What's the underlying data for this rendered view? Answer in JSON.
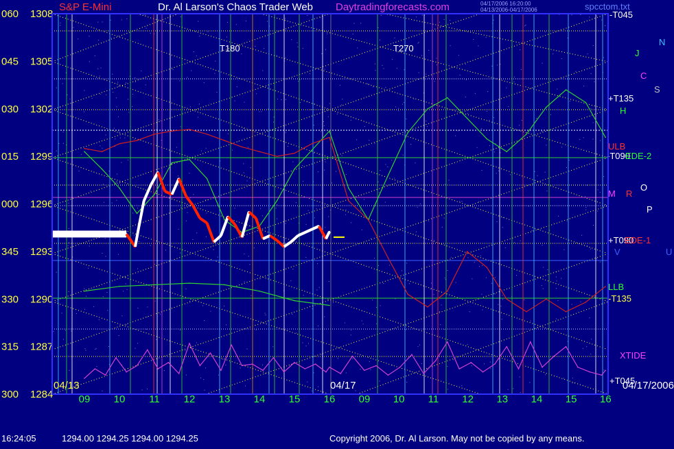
{
  "header": {
    "instrument": "S&P E-Mini",
    "title": "Dr. Al Larson's Chaos Trader Web",
    "site": "Daytradingforecasts.com",
    "stamp_line1": "04/17/2006 16:20:00",
    "stamp_line2": "04/13/2006-04/17/2006",
    "file": "spcctom.txt"
  },
  "footer": {
    "time": "16:24:05",
    "quote": "1294.00 1294.25 1294.00 1294.25",
    "copyright": "Copyright 2006, Dr. Al Larson. May not be copied by any means."
  },
  "colors": {
    "background": "#000080",
    "price_up": "#ffffff",
    "price_down": "#ff2000",
    "grid": "#ffff40",
    "green": "#30d030",
    "red": "#d02020",
    "magenta": "#d040d0",
    "cyan": "#40c0ff"
  },
  "chart_data": {
    "type": "line",
    "title": "",
    "ylim": [
      1284,
      1308
    ],
    "y_ticks": [
      {
        "angle": "060",
        "price": "1308",
        "value": 1308
      },
      {
        "angle": "045",
        "price": "1305",
        "value": 1305
      },
      {
        "angle": "030",
        "price": "1302",
        "value": 1302
      },
      {
        "angle": "015",
        "price": "1299",
        "value": 1299
      },
      {
        "angle": "000",
        "price": "1296",
        "value": 1296
      },
      {
        "angle": "345",
        "price": "1293",
        "value": 1293
      },
      {
        "angle": "330",
        "price": "1290",
        "value": 1290
      },
      {
        "angle": "315",
        "price": "1287",
        "value": 1287
      },
      {
        "angle": "300",
        "price": "1284",
        "value": 1284
      }
    ],
    "x_hours": [
      9,
      10,
      11,
      12,
      13,
      14,
      15,
      16,
      9,
      10,
      11,
      12,
      13,
      14,
      15,
      16
    ],
    "x_tick_labels": [
      "09",
      "10",
      "11",
      "12",
      "13",
      "14",
      "15",
      "16",
      "09",
      "10",
      "11",
      "12",
      "13",
      "14",
      "15",
      "16"
    ],
    "date_labels": [
      "04/13",
      "04/17",
      "04/17/2006"
    ],
    "mid_labels": [
      "T180",
      "T270"
    ],
    "right_labels": [
      "-T045",
      "+T135",
      "-T090",
      "+T090",
      "-T135",
      "+T045",
      "ULB",
      "LLB",
      "M",
      "R",
      "H",
      "O",
      "P",
      "N",
      "J",
      "C",
      "S",
      "V",
      "U",
      "XTIDE",
      "EDE-2",
      "EDE-1"
    ],
    "series": [
      {
        "name": "S&P E-Mini",
        "kind": "price",
        "x_hours": [
          9.3,
          10.2,
          10.45,
          10.55,
          10.7,
          10.9,
          11.1,
          11.3,
          11.5,
          11.7,
          11.9,
          12.1,
          12.3,
          12.5,
          12.7,
          12.9,
          13.1,
          13.3,
          13.5,
          13.7,
          13.9,
          14.1,
          14.3,
          14.5,
          14.7,
          14.9,
          15.1,
          15.3,
          15.5,
          15.7,
          15.9,
          16.0
        ],
        "values": [
          1294.1,
          1294.1,
          1293.3,
          1294.5,
          1296.2,
          1297.2,
          1298.0,
          1296.8,
          1296.6,
          1297.6,
          1296.5,
          1295.9,
          1295.1,
          1294.8,
          1293.6,
          1294.0,
          1295.2,
          1294.7,
          1293.9,
          1295.5,
          1295.1,
          1293.8,
          1294.0,
          1293.7,
          1293.3,
          1293.6,
          1294.0,
          1294.2,
          1294.4,
          1294.6,
          1293.8,
          1294.25
        ]
      },
      {
        "kind": "forecast",
        "color": "#d040d0",
        "x_hours": [
          9.0,
          9.3,
          9.6,
          9.9,
          10.2,
          10.5,
          10.8,
          11.1,
          11.4,
          11.7,
          12.0,
          12.3,
          12.6,
          12.9,
          13.2,
          13.5,
          13.8,
          14.1,
          14.4,
          14.7,
          15.0,
          15.3,
          15.6,
          15.9,
          16.0,
          16.3,
          16.6,
          16.9,
          17.2,
          17.5,
          17.8,
          18.1,
          18.4,
          18.7,
          19.0,
          19.3,
          19.6,
          19.9,
          20.2,
          20.5,
          20.8,
          21.1,
          21.4,
          21.7,
          22.0,
          22.3,
          22.6,
          22.9,
          23.0
        ],
        "values": [
          1285.0,
          1285.6,
          1285.2,
          1286.3,
          1285.4,
          1285.8,
          1286.8,
          1285.6,
          1286.0,
          1285.3,
          1287.2,
          1285.8,
          1286.6,
          1285.5,
          1287.1,
          1285.8,
          1285.9,
          1285.5,
          1286.3,
          1285.4,
          1286.0,
          1285.6,
          1285.9,
          1285.4,
          1285.7,
          1285.3,
          1286.4,
          1285.5,
          1285.8,
          1285.2,
          1285.7,
          1286.5,
          1285.3,
          1286.1,
          1287.3,
          1285.6,
          1286.0,
          1285.4,
          1285.9,
          1287.0,
          1285.6,
          1287.3,
          1285.7,
          1286.4,
          1287.0,
          1285.7,
          1285.4,
          1285.2,
          1285.5
        ]
      },
      {
        "kind": "forecast",
        "color": "#30d030",
        "x_hours": [
          9.0,
          9.5,
          10.0,
          10.5,
          11.0,
          11.5,
          12.0,
          12.5,
          13.0,
          13.5,
          14.0,
          14.5,
          15.0,
          15.5,
          16.0,
          16.5,
          17.0,
          17.5,
          18.0,
          18.5,
          19.0,
          19.5,
          20.0,
          20.5,
          21.0,
          21.5,
          22.0,
          22.5,
          23.0
        ],
        "values": [
          1299.3,
          1298.2,
          1297.0,
          1295.4,
          1296.6,
          1298.6,
          1298.8,
          1297.6,
          1295.0,
          1294.2,
          1294.6,
          1296.2,
          1298.2,
          1299.4,
          1300.6,
          1297.0,
          1295.0,
          1297.8,
          1300.5,
          1302.0,
          1302.7,
          1301.4,
          1300.1,
          1299.3,
          1300.4,
          1302.1,
          1303.2,
          1302.4,
          1300.2
        ]
      },
      {
        "kind": "forecast",
        "color": "#d02020",
        "x_hours": [
          9.0,
          9.5,
          10.0,
          10.5,
          11.0,
          11.5,
          12.0,
          12.5,
          13.0,
          13.5,
          14.0,
          14.5,
          15.0,
          15.5,
          16.0,
          16.5,
          17.0,
          17.5,
          18.0,
          18.5,
          19.0,
          19.5,
          20.0,
          20.5,
          21.0,
          21.5,
          22.0,
          22.5,
          23.0
        ],
        "values": [
          1299.5,
          1299.3,
          1299.8,
          1300.0,
          1300.4,
          1300.6,
          1300.7,
          1300.4,
          1300.0,
          1299.6,
          1299.3,
          1299.0,
          1299.2,
          1299.8,
          1300.2,
          1296.2,
          1295.0,
          1292.6,
          1290.3,
          1289.5,
          1290.5,
          1293.0,
          1292.0,
          1290.0,
          1289.2,
          1290.0,
          1289.2,
          1289.8,
          1290.8
        ]
      },
      {
        "kind": "forecast",
        "color": "#30d030",
        "x_hours": [
          9.0,
          10.0,
          11.0,
          12.0,
          13.0,
          14.0,
          15.0,
          16.0
        ],
        "values": [
          1290.5,
          1290.8,
          1290.9,
          1291.0,
          1290.9,
          1290.5,
          1289.9,
          1289.6
        ]
      }
    ]
  }
}
